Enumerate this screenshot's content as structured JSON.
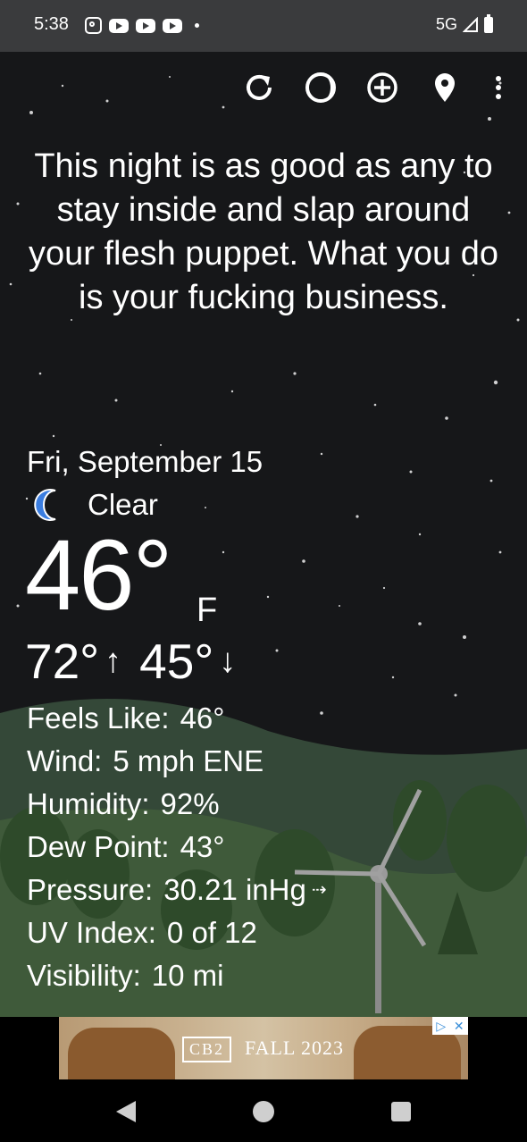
{
  "status": {
    "time": "5:38",
    "network": "5G"
  },
  "toolbar": {
    "icons": [
      "refresh-icon",
      "moon-phase-icon",
      "add-location-icon",
      "location-pin-icon",
      "overflow-menu-icon"
    ]
  },
  "message": "This night is as good as any to stay inside and slap around your flesh puppet. What you do is your fucking business.",
  "weather": {
    "date": "Fri, September 15",
    "condition": "Clear",
    "temperature": "46°",
    "unit": "F",
    "high": "72°",
    "low": "45°"
  },
  "details": {
    "feels_like_label": "Feels Like:",
    "feels_like": "46°",
    "wind_label": "Wind:",
    "wind": "5 mph ENE",
    "humidity_label": "Humidity:",
    "humidity": "92%",
    "dew_point_label": "Dew Point:",
    "dew_point": "43°",
    "pressure_label": "Pressure:",
    "pressure": "30.21 inHg",
    "uv_label": "UV Index:",
    "uv": "0 of 12",
    "visibility_label": "Visibility:",
    "visibility": "10 mi"
  },
  "ad": {
    "brand": "CB2",
    "text": "FALL 2023"
  },
  "colors": {
    "sky": "#161719",
    "hill": "#3f5a3a",
    "accent_moon": "#3a7de0"
  }
}
